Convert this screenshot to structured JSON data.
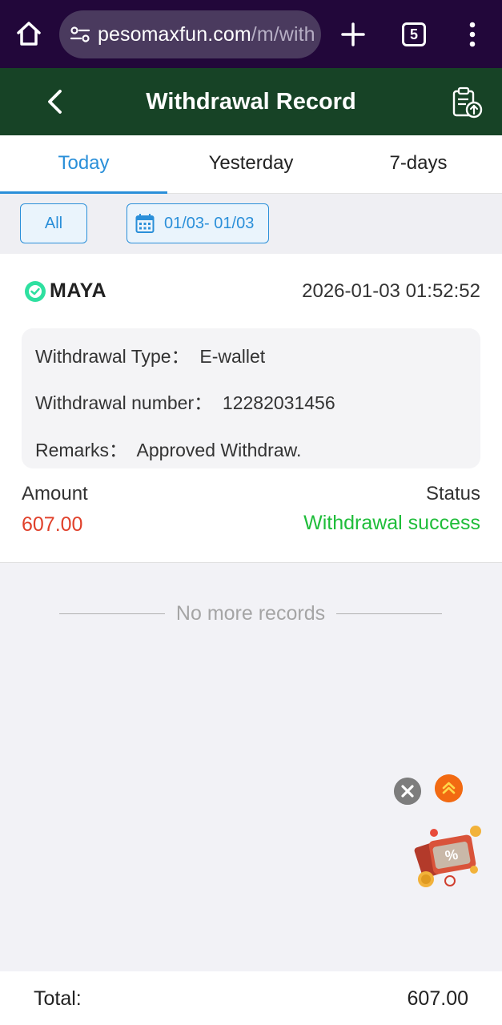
{
  "browser": {
    "url_domain": "pesomaxfun.com",
    "url_path": "/m/with",
    "tab_count": "5"
  },
  "header": {
    "title": "Withdrawal Record"
  },
  "tabs": [
    {
      "label": "Today",
      "active": true
    },
    {
      "label": "Yesterday",
      "active": false
    },
    {
      "label": "7-days",
      "active": false
    }
  ],
  "filters": {
    "all_label": "All",
    "date_range": "01/03- 01/03"
  },
  "record": {
    "provider": "MAYA",
    "time": "2026-01-03 01:52:52",
    "type_line": "Withdrawal Type：  E-wallet",
    "number_line": "Withdrawal number：  12282031456",
    "remarks_line": "Remarks：  Approved Withdraw.",
    "amount_label": "Amount",
    "amount_value": "607.00",
    "status_label": "Status",
    "status_value": "Withdrawal success"
  },
  "list_end_text": "No more records",
  "footer": {
    "total_label": "Total:",
    "total_value": "607.00"
  },
  "colors": {
    "browser_bar": "#22073a",
    "header": "#174326",
    "accent": "#2a8fd9",
    "amount": "#e0402a",
    "success": "#1fbd3a"
  }
}
